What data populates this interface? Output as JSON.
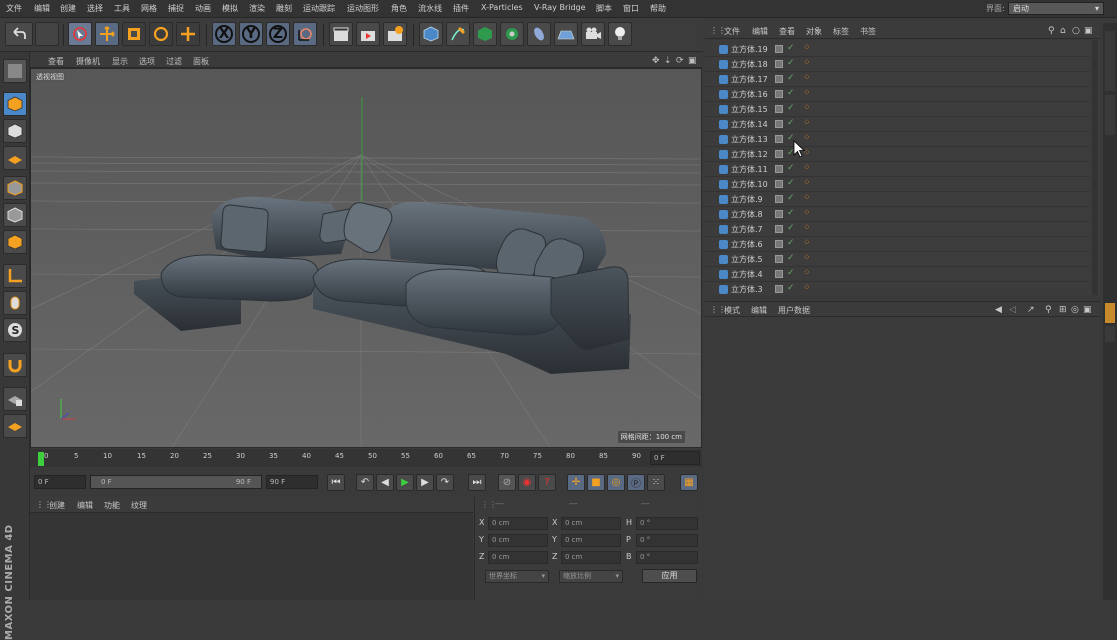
{
  "menubar": {
    "items": [
      "文件",
      "编辑",
      "创建",
      "选择",
      "工具",
      "网格",
      "捕捉",
      "动画",
      "模拟",
      "渲染",
      "雕刻",
      "运动跟踪",
      "运动图形",
      "角色",
      "流水线",
      "插件",
      "X-Particles",
      "V-Ray Bridge",
      "脚本",
      "窗口",
      "帮助"
    ],
    "layout_label": "界面:",
    "layout_value": "启动"
  },
  "toolbar": {
    "axis_x": "X",
    "axis_y": "Y",
    "axis_z": "Z"
  },
  "viewport": {
    "menu": [
      "查看",
      "摄像机",
      "显示",
      "选项",
      "过滤",
      "面板"
    ],
    "label": "透视视图",
    "grid_readout": "网格间距：100 cm"
  },
  "timeline": {
    "ticks": [
      "0",
      "5",
      "10",
      "15",
      "20",
      "25",
      "30",
      "35",
      "40",
      "45",
      "50",
      "55",
      "60",
      "65",
      "70",
      "75",
      "80",
      "85",
      "90"
    ],
    "current_frame": "0 F",
    "start_frame": "0 F",
    "range_start": "0 F",
    "range_end": "90 F",
    "end_frame": "90 F"
  },
  "material_manager": {
    "menu": [
      "创建",
      "编辑",
      "功能",
      "纹理"
    ]
  },
  "coordinates": {
    "header": [
      "---",
      "---",
      "---"
    ],
    "rows": [
      {
        "a": "X",
        "av": "0 cm",
        "b": "X",
        "bv": "0 cm",
        "c": "H",
        "cv": "0 °"
      },
      {
        "a": "Y",
        "av": "0 cm",
        "b": "Y",
        "bv": "0 cm",
        "c": "P",
        "cv": "0 °"
      },
      {
        "a": "Z",
        "av": "0 cm",
        "b": "Z",
        "bv": "0 cm",
        "c": "B",
        "cv": "0 °"
      }
    ],
    "mode_select": "世界坐标",
    "scale_select": "缩放比例",
    "apply_label": "应用"
  },
  "object_manager": {
    "menu": [
      "文件",
      "编辑",
      "查看",
      "对象",
      "标签",
      "书签"
    ],
    "objects": [
      "立方体.19",
      "立方体.18",
      "立方体.17",
      "立方体.16",
      "立方体.15",
      "立方体.14",
      "立方体.13",
      "立方体.12",
      "立方体.11",
      "立方体.10",
      "立方体.9",
      "立方体.8",
      "立方体.7",
      "立方体.6",
      "立方体.5",
      "立方体.4",
      "立方体.3"
    ]
  },
  "attribute_manager": {
    "menu": [
      "模式",
      "编辑",
      "用户数据"
    ]
  },
  "branding": {
    "logo_text": "MAXON CINEMA 4D"
  },
  "colors": {
    "accent_blue": "#4b88c8",
    "tag_orange": "#e08a1e",
    "play_green": "#3ecf3e"
  }
}
